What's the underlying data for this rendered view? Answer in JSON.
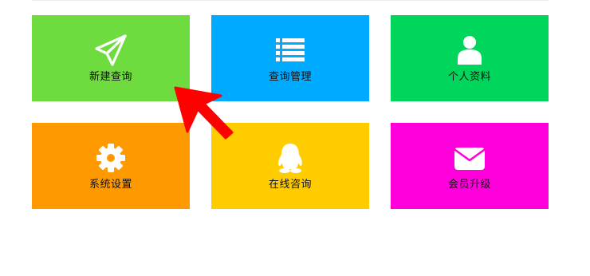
{
  "tiles": [
    {
      "label": "新建查询",
      "icon": "paper-plane-icon",
      "color": "#6edb3f"
    },
    {
      "label": "查询管理",
      "icon": "list-icon",
      "color": "#00aaff"
    },
    {
      "label": "个人资料",
      "icon": "user-icon",
      "color": "#00d65c"
    },
    {
      "label": "系统设置",
      "icon": "gear-icon",
      "color": "#ff9900"
    },
    {
      "label": "在线咨询",
      "icon": "qq-penguin-icon",
      "color": "#ffcc00"
    },
    {
      "label": "会员升级",
      "icon": "envelope-icon",
      "color": "#ff00dd"
    }
  ],
  "pointer": {
    "icon": "red-arrow-icon",
    "color": "#ff0000"
  }
}
